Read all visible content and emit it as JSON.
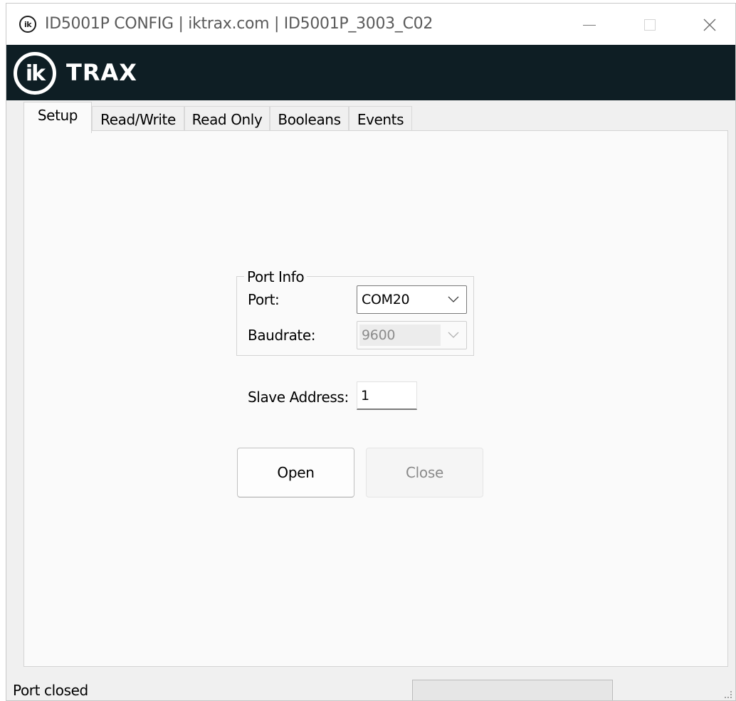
{
  "window": {
    "title": "ID5001P CONFIG | iktrax.com | ID5001P_3003_C02",
    "app_icon_text": "ik",
    "controls": {
      "minimize": "minimize-icon",
      "maximize": "maximize-icon",
      "close": "close-icon"
    }
  },
  "banner": {
    "logo_text": "ik",
    "brand_text": "TRAX",
    "background": "#0e1e24"
  },
  "tabs": [
    {
      "label": "Setup",
      "active": true
    },
    {
      "label": "Read/Write",
      "active": false
    },
    {
      "label": "Read Only",
      "active": false
    },
    {
      "label": "Booleans",
      "active": false
    },
    {
      "label": "Events",
      "active": false
    }
  ],
  "setup": {
    "port_info": {
      "legend": "Port Info",
      "port_label": "Port:",
      "port_value": "COM20",
      "baudrate_label": "Baudrate:",
      "baudrate_value": "9600"
    },
    "slave_address_label": "Slave Address:",
    "slave_address_value": "1",
    "open_label": "Open",
    "close_label": "Close"
  },
  "statusbar": {
    "status_text": "Port closed",
    "progress": 0
  }
}
